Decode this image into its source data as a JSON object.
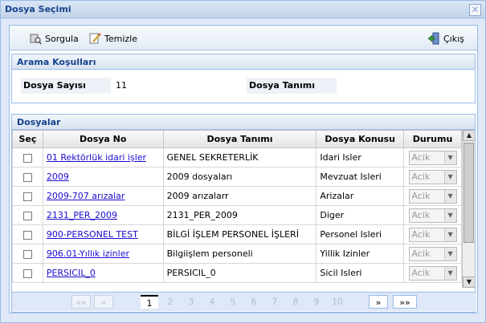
{
  "window": {
    "title": "Dosya Seçimi",
    "close_glyph": "✕"
  },
  "toolbar": {
    "query_label": "Sorgula",
    "clear_label": "Temizle",
    "exit_label": "Çıkış"
  },
  "search_panel": {
    "title": "Arama Koşulları",
    "file_count_label": "Dosya Sayısı",
    "file_count_value": "11",
    "file_desc_label": "Dosya Tanımı",
    "file_desc_value": ""
  },
  "files_panel": {
    "title": "Dosyalar",
    "columns": {
      "select": "Seç",
      "file_no": "Dosya No",
      "file_desc": "Dosya Tanımı",
      "file_subject": "Dosya Konusu",
      "status": "Durumu"
    },
    "rows": [
      {
        "file_no": "01 Rektörlük idari işler",
        "desc": "GENEL SEKRETERLİK",
        "subject": "Idari Isler",
        "status": "Acik"
      },
      {
        "file_no": "2009",
        "desc": "2009 dosyaları",
        "subject": "Mevzuat Isleri",
        "status": "Acik"
      },
      {
        "file_no": "2009-707 arızalar",
        "desc": "2009 arızalarr",
        "subject": "Arizalar",
        "status": "Acik"
      },
      {
        "file_no": "2131_PER_2009",
        "desc": "2131_PER_2009",
        "subject": "Diger",
        "status": "Acik"
      },
      {
        "file_no": "900-PERSONEL TEST",
        "desc": "BİLGİ İŞLEM PERSONEL İŞLERİ",
        "subject": "Personel Isleri",
        "status": "Acik"
      },
      {
        "file_no": "906.01-Yıllık izinler",
        "desc": "Bilgiişlem personeli",
        "subject": "Yillik Izinler",
        "status": "Acik"
      },
      {
        "file_no": "PERSICIL_0",
        "desc": "PERSICIL_0",
        "subject": "Sicil Isleri",
        "status": "Acik"
      }
    ]
  },
  "pager": {
    "first": "««",
    "prev": "«",
    "next": "»",
    "last": "»»",
    "pages": [
      "1",
      "2",
      "3",
      "4",
      "5",
      "6",
      "7",
      "8",
      "9",
      "10"
    ],
    "current": "1"
  }
}
